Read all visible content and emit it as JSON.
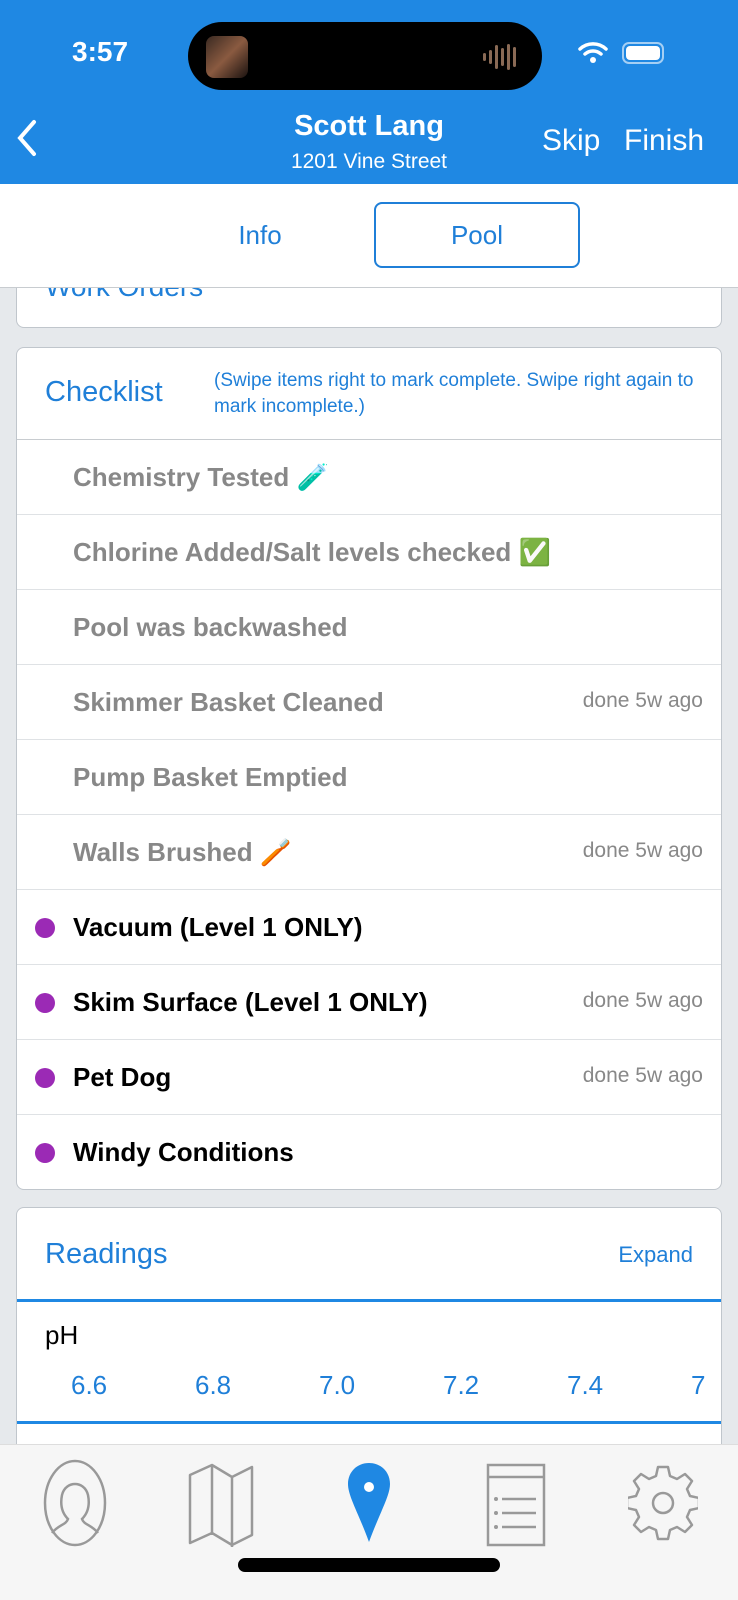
{
  "status_bar": {
    "time": "3:57"
  },
  "header": {
    "title": "Scott Lang",
    "subtitle": "1201 Vine Street",
    "skip_label": "Skip",
    "finish_label": "Finish"
  },
  "tabs": [
    {
      "label": "Info",
      "selected": false
    },
    {
      "label": "Pool",
      "selected": true
    }
  ],
  "work_orders": {
    "title": "Work Orders"
  },
  "checklist": {
    "title": "Checklist",
    "hint": "(Swipe items right to mark complete. Swipe right again to mark incomplete.)",
    "items": [
      {
        "label": "Chemistry Tested 🧪",
        "done": ""
      },
      {
        "label": "Chlorine Added/Salt levels checked ✅",
        "done": ""
      },
      {
        "label": "Pool was backwashed",
        "done": ""
      },
      {
        "label": "Skimmer Basket Cleaned",
        "done": "done 5w ago"
      },
      {
        "label": "Pump Basket Emptied",
        "done": ""
      },
      {
        "label": "Walls Brushed 🪥",
        "done": "done 5w ago"
      },
      {
        "label": "Vacuum (Level 1 ONLY)",
        "done": ""
      },
      {
        "label": "Skim Surface (Level 1 ONLY)",
        "done": "done 5w ago"
      },
      {
        "label": "Pet Dog",
        "done": "done 5w ago"
      },
      {
        "label": "Windy Conditions",
        "done": ""
      }
    ]
  },
  "readings": {
    "title": "Readings",
    "expand_label": "Expand",
    "ph": {
      "label": "pH",
      "values": [
        "6.6",
        "6.8",
        "7.0",
        "7.2",
        "7.4",
        "7"
      ]
    }
  },
  "tab_bar": {
    "items": [
      "customers",
      "map",
      "route",
      "list",
      "settings"
    ],
    "selected": "route"
  },
  "colors": {
    "brand": "#1f88e3",
    "accent": "#1f7fd8",
    "dot": "#9b2ab5"
  }
}
